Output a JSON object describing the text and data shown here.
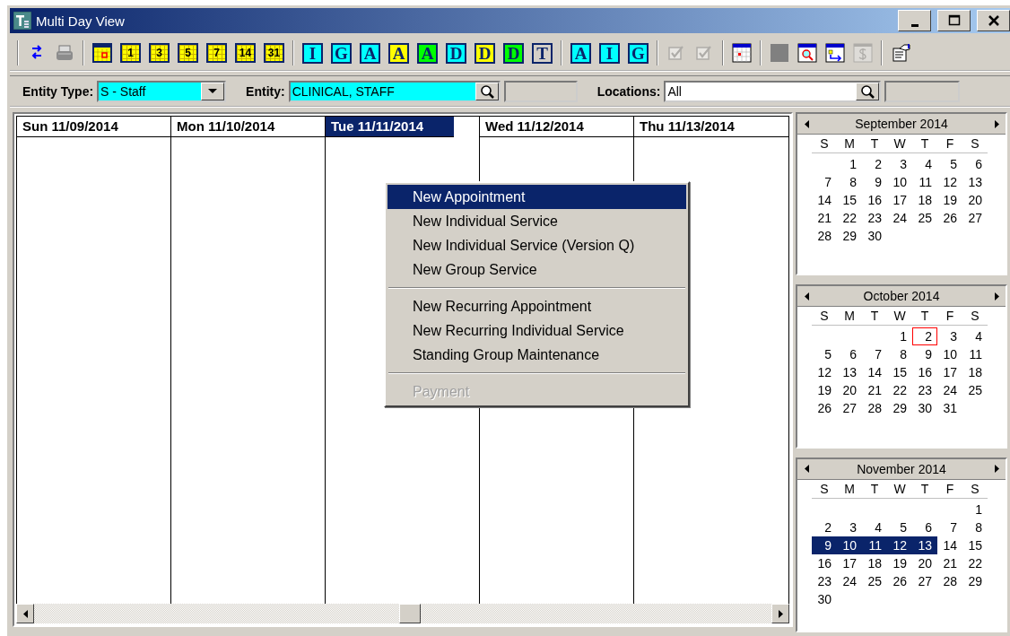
{
  "window": {
    "title": "Multi Day View"
  },
  "toolbar": [
    {
      "kind": "separator"
    },
    {
      "kind": "refresh",
      "disabled": false
    },
    {
      "kind": "print",
      "disabled": false
    },
    {
      "kind": "separator"
    },
    {
      "kind": "today",
      "disabled": false
    },
    {
      "kind": "grid",
      "label": "1",
      "disabled": false
    },
    {
      "kind": "grid",
      "label": "3",
      "disabled": false
    },
    {
      "kind": "grid",
      "label": "5",
      "disabled": false
    },
    {
      "kind": "grid",
      "label": "7",
      "disabled": false
    },
    {
      "kind": "grid",
      "label": "14",
      "disabled": false
    },
    {
      "kind": "grid",
      "label": "31",
      "disabled": false
    },
    {
      "kind": "separator"
    },
    {
      "kind": "letter",
      "label": "I",
      "color": "#00ffff",
      "disabled": false
    },
    {
      "kind": "letter",
      "label": "G",
      "color": "#00ffff",
      "disabled": false
    },
    {
      "kind": "letter",
      "label": "A",
      "color": "#00ffff",
      "disabled": false
    },
    {
      "kind": "letter",
      "label": "A",
      "color": "#ffff00",
      "disabled": false
    },
    {
      "kind": "letter",
      "label": "A",
      "color": "#00ff00",
      "disabled": false
    },
    {
      "kind": "letter",
      "label": "D",
      "color": "#00ffff",
      "disabled": false
    },
    {
      "kind": "letter",
      "label": "D",
      "color": "#ffff00",
      "disabled": false
    },
    {
      "kind": "letter",
      "label": "D",
      "color": "#00ff00",
      "disabled": false
    },
    {
      "kind": "letter",
      "label": "T",
      "color": "#d4d0c8",
      "disabled": false
    },
    {
      "kind": "separator"
    },
    {
      "kind": "letter",
      "label": "A",
      "color": "#00ffff",
      "disabled": false
    },
    {
      "kind": "letter",
      "label": "I",
      "color": "#00ffff",
      "disabled": false
    },
    {
      "kind": "letter",
      "label": "G",
      "color": "#00ffff",
      "disabled": false
    },
    {
      "kind": "separator"
    },
    {
      "kind": "check",
      "disabled": true
    },
    {
      "kind": "check",
      "disabled": true
    },
    {
      "kind": "separator"
    },
    {
      "kind": "calendar",
      "disabled": false
    },
    {
      "kind": "separator"
    },
    {
      "kind": "square",
      "disabled": false
    },
    {
      "kind": "calendar-search",
      "disabled": false
    },
    {
      "kind": "calendar-move",
      "disabled": false
    },
    {
      "kind": "dollar",
      "disabled": true
    },
    {
      "kind": "separator"
    },
    {
      "kind": "properties",
      "disabled": false
    }
  ],
  "filters": [
    {
      "kind": "combo",
      "label": "Entity Type:",
      "value": "S - Staff",
      "highlighted": true
    },
    {
      "kind": "lookup",
      "label": "Entity:",
      "value": "CLINICAL, STAFF",
      "highlighted": true
    },
    {
      "kind": "lookup",
      "label": "Locations:",
      "value": "All",
      "highlighted": false
    }
  ],
  "days": [
    {
      "label": "Sun 11/09/2014",
      "selected": false
    },
    {
      "label": "Mon 11/10/2014",
      "selected": false
    },
    {
      "label": "Tue 11/11/2014",
      "selected": true
    },
    {
      "label": "Wed 11/12/2014",
      "selected": false
    },
    {
      "label": "Thu 11/13/2014",
      "selected": false
    }
  ],
  "calendars": [
    {
      "title": "September 2014",
      "weekdays": [
        "S",
        "M",
        "T",
        "W",
        "T",
        "F",
        "S"
      ],
      "weeks": [
        [
          {
            "day": "1",
            "selected": false,
            "today": false
          },
          {
            "day": "2",
            "selected": false,
            "today": false
          },
          {
            "day": "3",
            "selected": false,
            "today": false
          },
          {
            "day": "4",
            "selected": false,
            "today": false
          },
          {
            "day": "5",
            "selected": false,
            "today": false
          },
          {
            "day": "6",
            "selected": false,
            "today": false
          }
        ],
        [
          {
            "day": "7",
            "selected": false,
            "today": false
          },
          {
            "day": "8",
            "selected": false,
            "today": false
          },
          {
            "day": "9",
            "selected": false,
            "today": false
          },
          {
            "day": "10",
            "selected": false,
            "today": false
          },
          {
            "day": "11",
            "selected": false,
            "today": false
          },
          {
            "day": "12",
            "selected": false,
            "today": false
          },
          {
            "day": "13",
            "selected": false,
            "today": false
          }
        ],
        [
          {
            "day": "14",
            "selected": false,
            "today": false
          },
          {
            "day": "15",
            "selected": false,
            "today": false
          },
          {
            "day": "16",
            "selected": false,
            "today": false
          },
          {
            "day": "17",
            "selected": false,
            "today": false
          },
          {
            "day": "18",
            "selected": false,
            "today": false
          },
          {
            "day": "19",
            "selected": false,
            "today": false
          },
          {
            "day": "20",
            "selected": false,
            "today": false
          }
        ],
        [
          {
            "day": "21",
            "selected": false,
            "today": false
          },
          {
            "day": "22",
            "selected": false,
            "today": false
          },
          {
            "day": "23",
            "selected": false,
            "today": false
          },
          {
            "day": "24",
            "selected": false,
            "today": false
          },
          {
            "day": "25",
            "selected": false,
            "today": false
          },
          {
            "day": "26",
            "selected": false,
            "today": false
          },
          {
            "day": "27",
            "selected": false,
            "today": false
          }
        ],
        [
          {
            "day": "28",
            "selected": false,
            "today": false
          },
          {
            "day": "29",
            "selected": false,
            "today": false
          },
          {
            "day": "30",
            "selected": false,
            "today": false
          }
        ]
      ]
    },
    {
      "title": "October 2014",
      "weekdays": [
        "S",
        "M",
        "T",
        "W",
        "T",
        "F",
        "S"
      ],
      "weeks": [
        [
          {
            "day": "1",
            "selected": false,
            "today": false
          },
          {
            "day": "2",
            "selected": false,
            "today": true
          },
          {
            "day": "3",
            "selected": false,
            "today": false
          },
          {
            "day": "4",
            "selected": false,
            "today": false
          }
        ],
        [
          {
            "day": "5",
            "selected": false,
            "today": false
          },
          {
            "day": "6",
            "selected": false,
            "today": false
          },
          {
            "day": "7",
            "selected": false,
            "today": false
          },
          {
            "day": "8",
            "selected": false,
            "today": false
          },
          {
            "day": "9",
            "selected": false,
            "today": false
          },
          {
            "day": "10",
            "selected": false,
            "today": false
          },
          {
            "day": "11",
            "selected": false,
            "today": false
          }
        ],
        [
          {
            "day": "12",
            "selected": false,
            "today": false
          },
          {
            "day": "13",
            "selected": false,
            "today": false
          },
          {
            "day": "14",
            "selected": false,
            "today": false
          },
          {
            "day": "15",
            "selected": false,
            "today": false
          },
          {
            "day": "16",
            "selected": false,
            "today": false
          },
          {
            "day": "17",
            "selected": false,
            "today": false
          },
          {
            "day": "18",
            "selected": false,
            "today": false
          }
        ],
        [
          {
            "day": "19",
            "selected": false,
            "today": false
          },
          {
            "day": "20",
            "selected": false,
            "today": false
          },
          {
            "day": "21",
            "selected": false,
            "today": false
          },
          {
            "day": "22",
            "selected": false,
            "today": false
          },
          {
            "day": "23",
            "selected": false,
            "today": false
          },
          {
            "day": "24",
            "selected": false,
            "today": false
          },
          {
            "day": "25",
            "selected": false,
            "today": false
          }
        ],
        [
          {
            "day": "26",
            "selected": false,
            "today": false
          },
          {
            "day": "27",
            "selected": false,
            "today": false
          },
          {
            "day": "28",
            "selected": false,
            "today": false
          },
          {
            "day": "29",
            "selected": false,
            "today": false
          },
          {
            "day": "30",
            "selected": false,
            "today": false
          },
          {
            "day": "31",
            "selected": false,
            "today": false
          }
        ]
      ]
    },
    {
      "title": "November 2014",
      "weekdays": [
        "S",
        "M",
        "T",
        "W",
        "T",
        "F",
        "S"
      ],
      "weeks": [
        [
          {
            "day": "1",
            "selected": false,
            "today": false
          }
        ],
        [
          {
            "day": "2",
            "selected": false,
            "today": false
          },
          {
            "day": "3",
            "selected": false,
            "today": false
          },
          {
            "day": "4",
            "selected": false,
            "today": false
          },
          {
            "day": "5",
            "selected": false,
            "today": false
          },
          {
            "day": "6",
            "selected": false,
            "today": false
          },
          {
            "day": "7",
            "selected": false,
            "today": false
          },
          {
            "day": "8",
            "selected": false,
            "today": false
          }
        ],
        [
          {
            "day": "9",
            "selected": true,
            "today": false
          },
          {
            "day": "10",
            "selected": true,
            "today": false
          },
          {
            "day": "11",
            "selected": true,
            "today": false
          },
          {
            "day": "12",
            "selected": true,
            "today": false
          },
          {
            "day": "13",
            "selected": true,
            "today": false
          },
          {
            "day": "14",
            "selected": false,
            "today": false
          },
          {
            "day": "15",
            "selected": false,
            "today": false
          }
        ],
        [
          {
            "day": "16",
            "selected": false,
            "today": false
          },
          {
            "day": "17",
            "selected": false,
            "today": false
          },
          {
            "day": "18",
            "selected": false,
            "today": false
          },
          {
            "day": "19",
            "selected": false,
            "today": false
          },
          {
            "day": "20",
            "selected": false,
            "today": false
          },
          {
            "day": "21",
            "selected": false,
            "today": false
          },
          {
            "day": "22",
            "selected": false,
            "today": false
          }
        ],
        [
          {
            "day": "23",
            "selected": false,
            "today": false
          },
          {
            "day": "24",
            "selected": false,
            "today": false
          },
          {
            "day": "25",
            "selected": false,
            "today": false
          },
          {
            "day": "26",
            "selected": false,
            "today": false
          },
          {
            "day": "27",
            "selected": false,
            "today": false
          },
          {
            "day": "28",
            "selected": false,
            "today": false
          },
          {
            "day": "29",
            "selected": false,
            "today": false
          }
        ],
        [
          {
            "day": "30",
            "selected": false,
            "today": false
          }
        ]
      ]
    }
  ],
  "context_menu": {
    "items": [
      {
        "kind": "item",
        "label": "New Appointment",
        "selected": true,
        "disabled": false
      },
      {
        "kind": "item",
        "label": "New Individual Service",
        "selected": false,
        "disabled": false
      },
      {
        "kind": "item",
        "label": "New Individual Service (Version Q)",
        "selected": false,
        "disabled": false
      },
      {
        "kind": "item",
        "label": "New Group Service",
        "selected": false,
        "disabled": false
      },
      {
        "kind": "separator"
      },
      {
        "kind": "item",
        "label": "New Recurring Appointment",
        "selected": false,
        "disabled": false
      },
      {
        "kind": "item",
        "label": "New Recurring Individual Service",
        "selected": false,
        "disabled": false
      },
      {
        "kind": "item",
        "label": "Standing Group Maintenance",
        "selected": false,
        "disabled": false
      },
      {
        "kind": "separator"
      },
      {
        "kind": "item",
        "label": "Payment",
        "selected": false,
        "disabled": true
      }
    ]
  }
}
